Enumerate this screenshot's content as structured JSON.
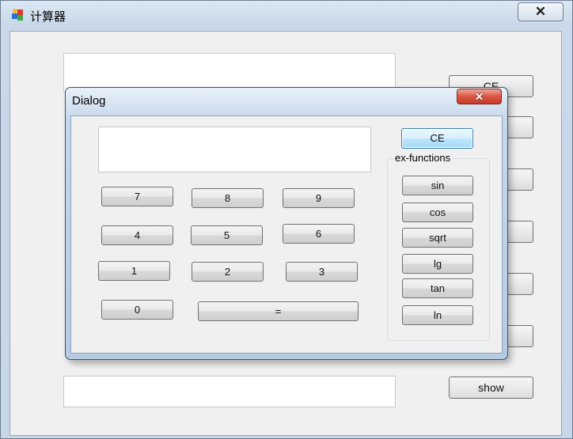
{
  "outer_window": {
    "title": "计算器",
    "close_glyph": "✕",
    "right_buttons": [
      "CE",
      "",
      "",
      "",
      "",
      "",
      ""
    ],
    "show_label": "show"
  },
  "dialog": {
    "title": "Dialog",
    "close_glyph": "✕",
    "ce_label": "CE",
    "numpad": {
      "k7": "7",
      "k8": "8",
      "k9": "9",
      "k4": "4",
      "k5": "5",
      "k6": "6",
      "k1": "1",
      "k2": "2",
      "k3": "3",
      "k0": "0",
      "equals": "="
    },
    "ex_functions": {
      "legend": "ex-functions",
      "sin": "sin",
      "cos": "cos",
      "sqrt": "sqrt",
      "lg": "lg",
      "tan": "tan",
      "ln": "ln"
    }
  }
}
